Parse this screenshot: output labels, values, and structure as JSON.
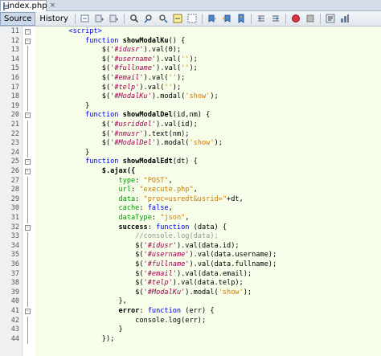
{
  "tab": {
    "title": "index.php"
  },
  "toolbar": {
    "source_label": "Source",
    "history_label": "History"
  },
  "lines": [
    {
      "n": "11",
      "fold": "-",
      "indent": "        ",
      "tokens": [
        {
          "t": "<script>",
          "c": "tag"
        }
      ]
    },
    {
      "n": "12",
      "fold": "-",
      "indent": "            ",
      "tokens": [
        {
          "t": "function ",
          "c": "kw"
        },
        {
          "t": "showModalKu",
          "c": "fn"
        },
        {
          "t": "() {",
          "c": ""
        }
      ]
    },
    {
      "n": "13",
      "fold": "",
      "indent": "                ",
      "tokens": [
        {
          "t": "$(",
          "c": ""
        },
        {
          "t": "'#idusr'",
          "c": "sel"
        },
        {
          "t": ").val(0);",
          "c": ""
        }
      ]
    },
    {
      "n": "14",
      "fold": "",
      "indent": "                ",
      "tokens": [
        {
          "t": "$(",
          "c": ""
        },
        {
          "t": "'#username'",
          "c": "sel"
        },
        {
          "t": ").val(",
          "c": ""
        },
        {
          "t": "''",
          "c": "str"
        },
        {
          "t": ");",
          "c": ""
        }
      ]
    },
    {
      "n": "15",
      "fold": "",
      "indent": "                ",
      "tokens": [
        {
          "t": "$(",
          "c": ""
        },
        {
          "t": "'#fullname'",
          "c": "sel"
        },
        {
          "t": ").val(",
          "c": ""
        },
        {
          "t": "''",
          "c": "str"
        },
        {
          "t": ");",
          "c": ""
        }
      ]
    },
    {
      "n": "16",
      "fold": "",
      "indent": "                ",
      "tokens": [
        {
          "t": "$(",
          "c": ""
        },
        {
          "t": "'#email'",
          "c": "sel"
        },
        {
          "t": ").val(",
          "c": ""
        },
        {
          "t": "''",
          "c": "str"
        },
        {
          "t": ");",
          "c": ""
        }
      ]
    },
    {
      "n": "17",
      "fold": "",
      "indent": "                ",
      "tokens": [
        {
          "t": "$(",
          "c": ""
        },
        {
          "t": "'#telp'",
          "c": "sel"
        },
        {
          "t": ").val(",
          "c": ""
        },
        {
          "t": "''",
          "c": "str"
        },
        {
          "t": ");",
          "c": ""
        }
      ]
    },
    {
      "n": "18",
      "fold": "",
      "indent": "                ",
      "tokens": [
        {
          "t": "$(",
          "c": ""
        },
        {
          "t": "'#ModalKu'",
          "c": "sel"
        },
        {
          "t": ").modal(",
          "c": ""
        },
        {
          "t": "'show'",
          "c": "str"
        },
        {
          "t": ");",
          "c": ""
        }
      ]
    },
    {
      "n": "19",
      "fold": "",
      "indent": "            ",
      "tokens": [
        {
          "t": "}",
          "c": ""
        }
      ]
    },
    {
      "n": "20",
      "fold": "-",
      "indent": "            ",
      "tokens": [
        {
          "t": "function ",
          "c": "kw"
        },
        {
          "t": "showModalDel",
          "c": "fn"
        },
        {
          "t": "(id,nm) {",
          "c": ""
        }
      ]
    },
    {
      "n": "21",
      "fold": "",
      "indent": "                ",
      "tokens": [
        {
          "t": "$(",
          "c": ""
        },
        {
          "t": "'#usriddel'",
          "c": "sel"
        },
        {
          "t": ").val(id);",
          "c": ""
        }
      ]
    },
    {
      "n": "22",
      "fold": "",
      "indent": "                ",
      "tokens": [
        {
          "t": "$(",
          "c": ""
        },
        {
          "t": "'#nmusr'",
          "c": "sel"
        },
        {
          "t": ").text(nm);",
          "c": ""
        }
      ]
    },
    {
      "n": "23",
      "fold": "",
      "indent": "                ",
      "tokens": [
        {
          "t": "$(",
          "c": ""
        },
        {
          "t": "'#ModalDel'",
          "c": "sel"
        },
        {
          "t": ").modal(",
          "c": ""
        },
        {
          "t": "'show'",
          "c": "str"
        },
        {
          "t": ");",
          "c": ""
        }
      ]
    },
    {
      "n": "24",
      "fold": "",
      "indent": "            ",
      "tokens": [
        {
          "t": "}",
          "c": ""
        }
      ]
    },
    {
      "n": "25",
      "fold": "-",
      "indent": "            ",
      "tokens": [
        {
          "t": "function ",
          "c": "kw"
        },
        {
          "t": "showModalEdt",
          "c": "fn"
        },
        {
          "t": "(dt) {",
          "c": ""
        }
      ]
    },
    {
      "n": "26",
      "fold": "-",
      "indent": "                ",
      "tokens": [
        {
          "t": "$.ajax({",
          "c": "b"
        }
      ]
    },
    {
      "n": "27",
      "fold": "",
      "indent": "                    ",
      "tokens": [
        {
          "t": "type",
          "c": "prop"
        },
        {
          "t": ": ",
          "c": ""
        },
        {
          "t": "\"POST\"",
          "c": "str"
        },
        {
          "t": ",",
          "c": ""
        }
      ]
    },
    {
      "n": "28",
      "fold": "",
      "indent": "                    ",
      "tokens": [
        {
          "t": "url",
          "c": "prop"
        },
        {
          "t": ": ",
          "c": ""
        },
        {
          "t": "\"execute.php\"",
          "c": "str"
        },
        {
          "t": ",",
          "c": ""
        }
      ]
    },
    {
      "n": "29",
      "fold": "",
      "indent": "                    ",
      "tokens": [
        {
          "t": "data",
          "c": "prop"
        },
        {
          "t": ": ",
          "c": ""
        },
        {
          "t": "\"proc=usredt&usrid=\"",
          "c": "str"
        },
        {
          "t": "+dt,",
          "c": ""
        }
      ]
    },
    {
      "n": "30",
      "fold": "",
      "indent": "                    ",
      "tokens": [
        {
          "t": "cache",
          "c": "prop"
        },
        {
          "t": ": ",
          "c": ""
        },
        {
          "t": "false",
          "c": "kw"
        },
        {
          "t": ",",
          "c": ""
        }
      ]
    },
    {
      "n": "31",
      "fold": "",
      "indent": "                    ",
      "tokens": [
        {
          "t": "dataType",
          "c": "prop"
        },
        {
          "t": ": ",
          "c": ""
        },
        {
          "t": "\"json\"",
          "c": "str"
        },
        {
          "t": ",",
          "c": ""
        }
      ]
    },
    {
      "n": "32",
      "fold": "-",
      "indent": "                    ",
      "tokens": [
        {
          "t": "success",
          "c": "b"
        },
        {
          "t": ": ",
          "c": ""
        },
        {
          "t": "function ",
          "c": "kw"
        },
        {
          "t": "(data) {",
          "c": ""
        }
      ]
    },
    {
      "n": "33",
      "fold": "",
      "indent": "                        ",
      "tokens": [
        {
          "t": "//console.log(data);",
          "c": "cmt"
        }
      ]
    },
    {
      "n": "34",
      "fold": "",
      "indent": "                        ",
      "tokens": [
        {
          "t": "$(",
          "c": ""
        },
        {
          "t": "'#idusr'",
          "c": "sel"
        },
        {
          "t": ").val(data.id);",
          "c": ""
        }
      ]
    },
    {
      "n": "35",
      "fold": "",
      "indent": "                        ",
      "tokens": [
        {
          "t": "$(",
          "c": ""
        },
        {
          "t": "'#username'",
          "c": "sel"
        },
        {
          "t": ").val(data.username);",
          "c": ""
        }
      ]
    },
    {
      "n": "36",
      "fold": "",
      "indent": "                        ",
      "tokens": [
        {
          "t": "$(",
          "c": ""
        },
        {
          "t": "'#fullname'",
          "c": "sel"
        },
        {
          "t": ").val(data.fullname);",
          "c": ""
        }
      ]
    },
    {
      "n": "37",
      "fold": "",
      "indent": "                        ",
      "tokens": [
        {
          "t": "$(",
          "c": ""
        },
        {
          "t": "'#email'",
          "c": "sel"
        },
        {
          "t": ").val(data.email);",
          "c": ""
        }
      ]
    },
    {
      "n": "38",
      "fold": "",
      "indent": "                        ",
      "tokens": [
        {
          "t": "$(",
          "c": ""
        },
        {
          "t": "'#telp'",
          "c": "sel"
        },
        {
          "t": ").val(data.telp);",
          "c": ""
        }
      ]
    },
    {
      "n": "39",
      "fold": "",
      "indent": "                        ",
      "tokens": [
        {
          "t": "$(",
          "c": ""
        },
        {
          "t": "'#ModalKu'",
          "c": "sel"
        },
        {
          "t": ").modal(",
          "c": ""
        },
        {
          "t": "'show'",
          "c": "str"
        },
        {
          "t": ");",
          "c": ""
        }
      ]
    },
    {
      "n": "40",
      "fold": "",
      "indent": "                    ",
      "tokens": [
        {
          "t": "},",
          "c": ""
        }
      ]
    },
    {
      "n": "41",
      "fold": "-",
      "indent": "                    ",
      "tokens": [
        {
          "t": "error",
          "c": "b"
        },
        {
          "t": ": ",
          "c": ""
        },
        {
          "t": "function ",
          "c": "kw"
        },
        {
          "t": "(err) {",
          "c": ""
        }
      ]
    },
    {
      "n": "42",
      "fold": "",
      "indent": "                        ",
      "tokens": [
        {
          "t": "console.log(err);",
          "c": ""
        }
      ]
    },
    {
      "n": "43",
      "fold": "",
      "indent": "                    ",
      "tokens": [
        {
          "t": "}",
          "c": ""
        }
      ]
    },
    {
      "n": "44",
      "fold": "",
      "indent": "                ",
      "tokens": [
        {
          "t": "});",
          "c": ""
        }
      ]
    }
  ]
}
